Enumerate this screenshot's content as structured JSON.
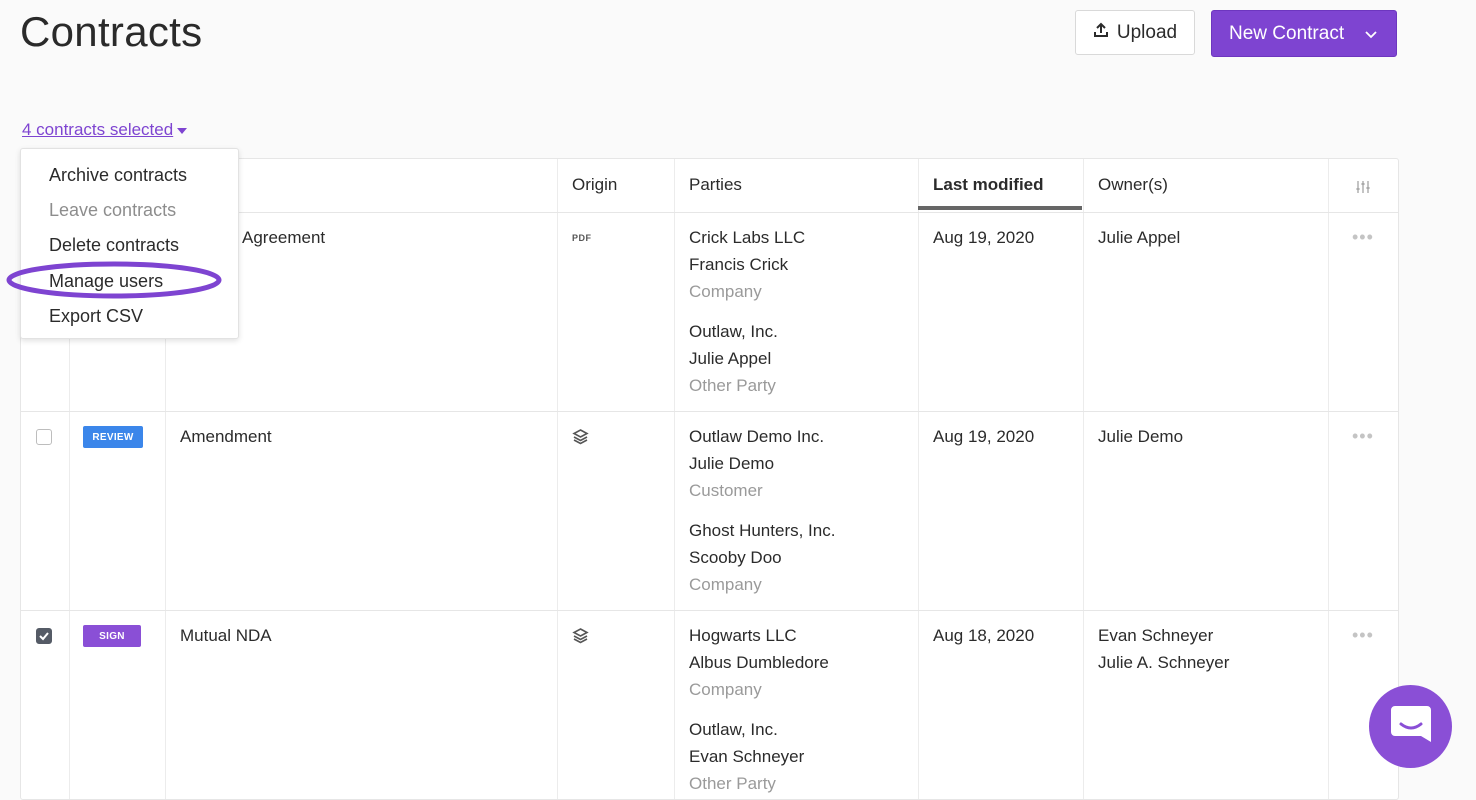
{
  "header": {
    "title": "Contracts",
    "upload_label": "Upload",
    "new_contract_label": "New Contract"
  },
  "selection": {
    "label": "4 contracts selected"
  },
  "bulk_menu": {
    "items": [
      {
        "label": "Archive contracts",
        "enabled": true
      },
      {
        "label": "Leave contracts",
        "enabled": false
      },
      {
        "label": "Delete contracts",
        "enabled": true
      },
      {
        "label": "Manage users",
        "enabled": true,
        "highlighted": true
      },
      {
        "label": "Export CSV",
        "enabled": true
      }
    ]
  },
  "table": {
    "columns": [
      "Origin",
      "Parties",
      "Last modified",
      "Owner(s)"
    ],
    "active_sort_column": "Last modified",
    "rows": [
      {
        "checked": true,
        "status": "",
        "name": "Agreement",
        "origin": "PDF",
        "parties": [
          {
            "org": "Crick Labs LLC",
            "person": "Francis Crick",
            "role": "Company"
          },
          {
            "org": "Outlaw, Inc.",
            "person": "Julie Appel",
            "role": "Other Party"
          }
        ],
        "last_modified": "Aug 19, 2020",
        "owners": [
          "Julie Appel"
        ]
      },
      {
        "checked": false,
        "status": "REVIEW",
        "status_color": "#3b86ea",
        "name": "Amendment",
        "origin": "layers",
        "parties": [
          {
            "org": "Outlaw Demo Inc.",
            "person": "Julie Demo",
            "role": "Customer"
          },
          {
            "org": "Ghost Hunters, Inc.",
            "person": "Scooby Doo",
            "role": "Company"
          }
        ],
        "last_modified": "Aug 19, 2020",
        "owners": [
          "Julie Demo"
        ]
      },
      {
        "checked": true,
        "status": "SIGN",
        "status_color": "#8a4fd6",
        "name": "Mutual NDA",
        "origin": "layers",
        "parties": [
          {
            "org": "Hogwarts LLC",
            "person": "Albus Dumbledore",
            "role": "Company"
          },
          {
            "org": "Outlaw, Inc.",
            "person": "Evan Schneyer",
            "role": "Other Party"
          }
        ],
        "last_modified": "Aug 18, 2020",
        "owners": [
          "Evan Schneyer",
          "Julie A. Schneyer"
        ]
      }
    ]
  },
  "colors": {
    "brand": "#7e44d1",
    "review": "#3b86ea",
    "sign": "#8a4fd6",
    "highlight_ring": "#7e44d1"
  },
  "icons": [
    "upload-icon",
    "chevron-down-icon",
    "caret-down-icon",
    "column-settings-icon",
    "pdf-icon",
    "layers-icon",
    "more-options-icon",
    "check-icon",
    "chat-icon"
  ]
}
